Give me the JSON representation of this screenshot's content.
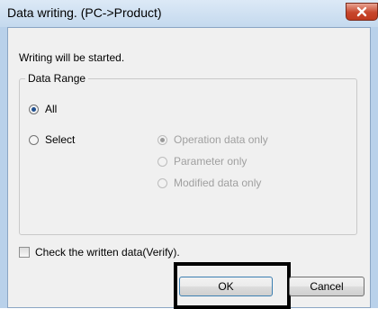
{
  "window": {
    "title": "Data writing. (PC->Product)"
  },
  "message": "Writing will be started.",
  "data_range": {
    "legend": "Data Range",
    "options": [
      {
        "label": "All",
        "checked": true,
        "enabled": true
      },
      {
        "label": "Select",
        "checked": false,
        "enabled": true
      }
    ],
    "sub_options": [
      {
        "label": "Operation data only",
        "checked": true,
        "enabled": false
      },
      {
        "label": "Parameter only",
        "checked": false,
        "enabled": false
      },
      {
        "label": "Modified data only",
        "checked": false,
        "enabled": false
      }
    ]
  },
  "verify": {
    "label": "Check the written data(Verify).",
    "checked": false
  },
  "buttons": {
    "ok": "OK",
    "cancel": "Cancel"
  },
  "colors": {
    "title_bar": "#c4d9ee",
    "close_button": "#c7462c",
    "highlight_border": "#000000"
  },
  "icons": {
    "close": "close-x-icon"
  }
}
